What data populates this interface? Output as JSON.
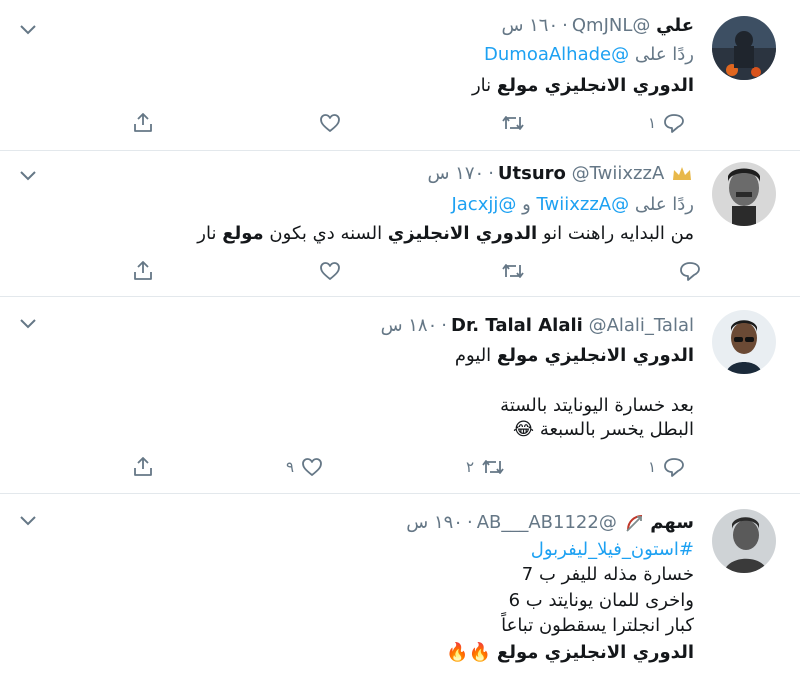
{
  "tweets": [
    {
      "name": "علي",
      "handle": "@QmJNL",
      "time": "١٦٠ س",
      "reply_prefix": "ردًا على",
      "reply_to": "@DumoaAlhade",
      "lines": [
        {
          "bold": "الدوري الانجليزي مولع",
          "rest": " نار"
        }
      ],
      "reply_count": "١",
      "retweet_count": "",
      "like_count": ""
    },
    {
      "name": "Utsuro",
      "badge": "crown-icon",
      "handle": "@TwiixzzA",
      "time": "١٧٠ س",
      "reply_prefix": "ردًا على",
      "reply_to_1": "@TwiixzzA",
      "reply_joiner": "و",
      "reply_to_2": "@Jacxjj",
      "line_parts": [
        "من البدايه راهنت انو ",
        "الدوري الانجليزي",
        " السنه دي بكون ",
        "مولع",
        " نار"
      ],
      "reply_count": "",
      "retweet_count": "",
      "like_count": ""
    },
    {
      "name": "Dr. Talal Alali",
      "handle": "@Alali_Talal",
      "time": "١٨٠ س",
      "line1_bold": "الدوري الانجليزي مولع",
      "line1_rest": " اليوم",
      "line2": "بعد خسارة اليونايتد بالستة",
      "line3": "البطل يخسر بالسبعة",
      "line3_emoji": "😂",
      "reply_count": "١",
      "retweet_count": "٢",
      "like_count": "٩"
    },
    {
      "name": "سهم",
      "badge": "bow-arrow-icon",
      "handle": "@AB___AB1122",
      "time": "١٩٠ س",
      "hashtag": "#استون_فيلا_ليفربول",
      "line1": "خسارة مذله لليفر ب 7",
      "line2": "واخرى للمان يونايتد ب 6",
      "line3": "كبار انجلترا يسقطون تباعاً",
      "line4_bold": "الدوري الانجليزي مولع",
      "line4_emoji": "🔥🔥"
    }
  ],
  "colors": {
    "link": "#1da1f2",
    "muted": "#657786",
    "text": "#14171a",
    "divider": "#e3e8ec"
  }
}
